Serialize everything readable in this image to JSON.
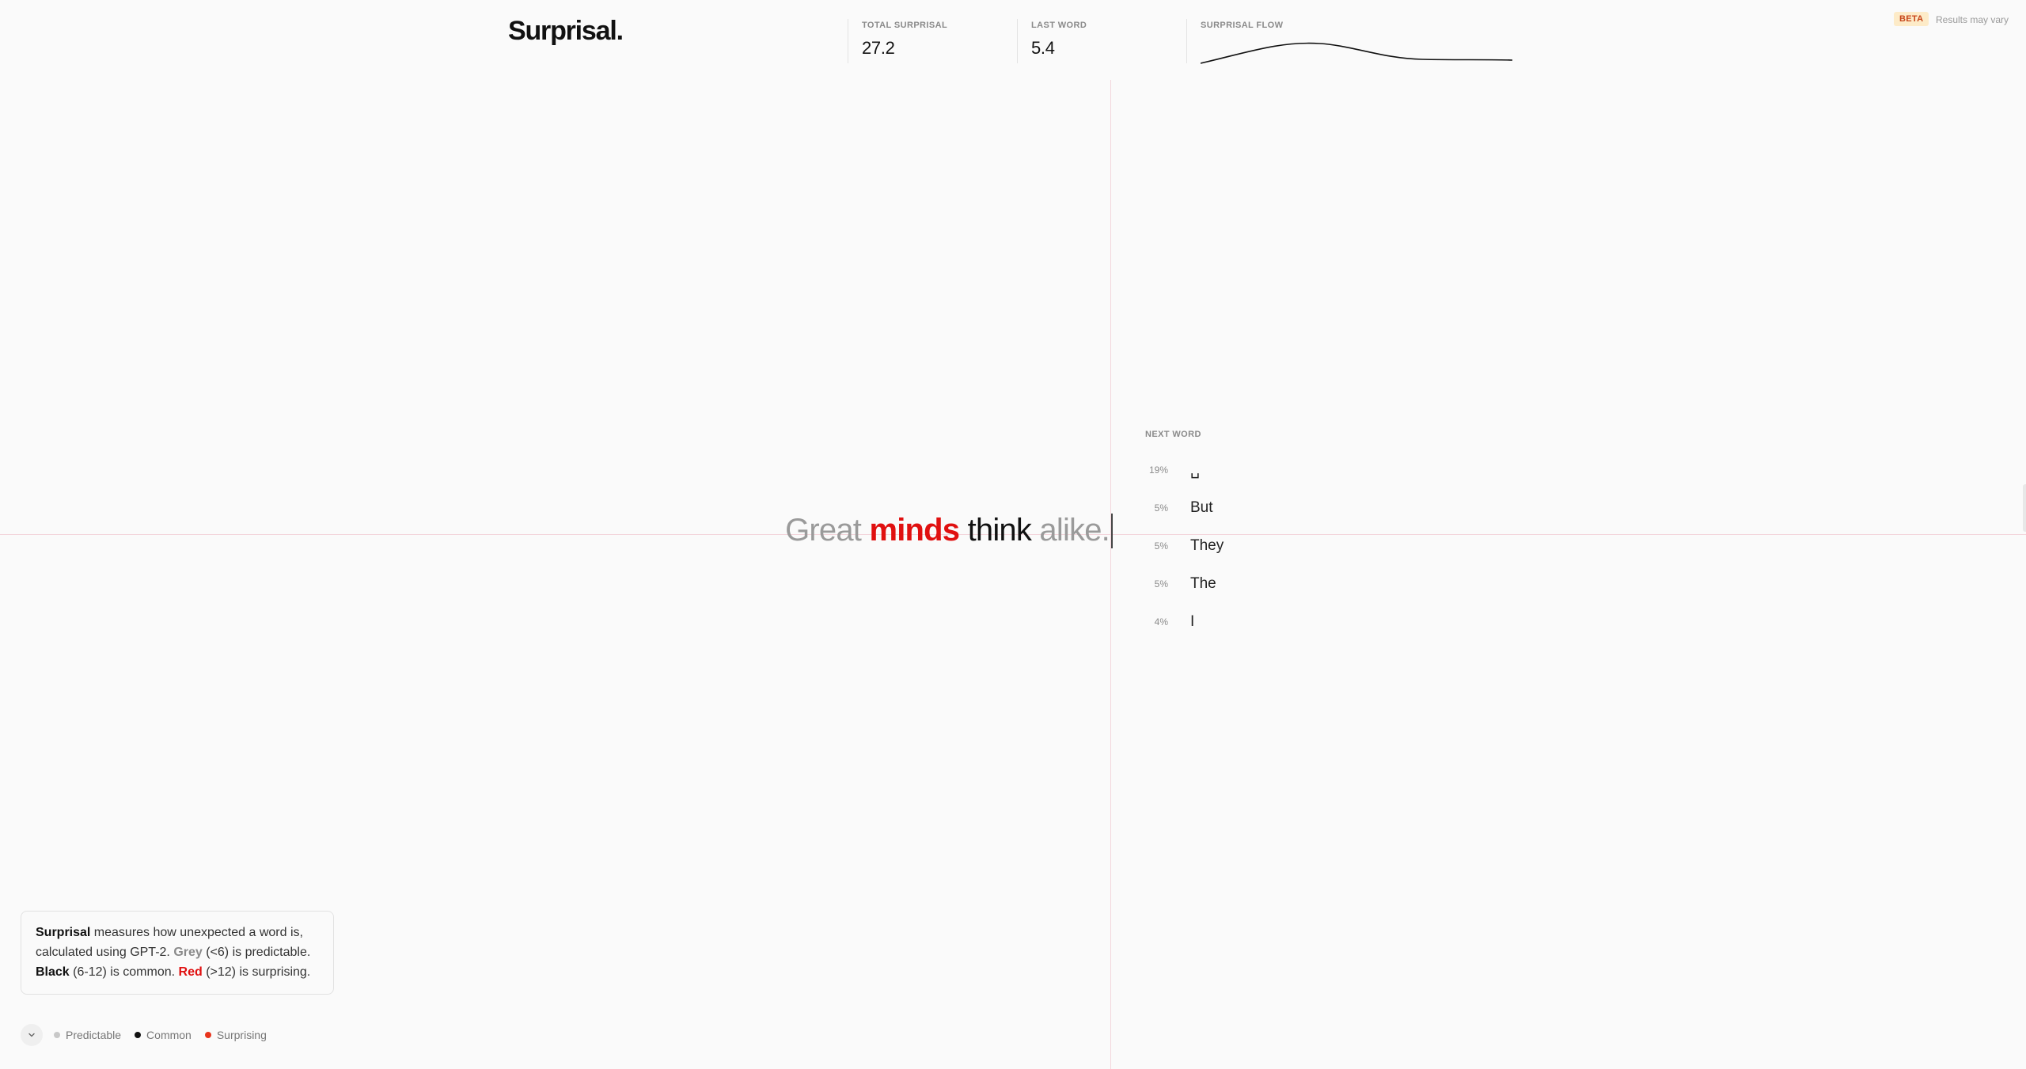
{
  "header": {
    "logo": "Surprisal.",
    "stats": [
      {
        "label": "TOTAL SURPRISAL",
        "value": "27.2"
      },
      {
        "label": "LAST WORD",
        "value": "5.4"
      },
      {
        "label": "SURPRISAL FLOW"
      }
    ],
    "badge": "BETA",
    "badge_note": "Results may vary"
  },
  "sentence": {
    "words": [
      {
        "text": "Great",
        "level": "grey"
      },
      {
        "text": "minds",
        "level": "red"
      },
      {
        "text": "think",
        "level": "black"
      },
      {
        "text": "alike.",
        "level": "grey"
      }
    ]
  },
  "next_word": {
    "title": "NEXT WORD",
    "items": [
      {
        "pct": "19%",
        "word": "␣"
      },
      {
        "pct": "5%",
        "word": "But"
      },
      {
        "pct": "5%",
        "word": "They"
      },
      {
        "pct": "5%",
        "word": "The"
      },
      {
        "pct": "4%",
        "word": "I"
      }
    ]
  },
  "info": {
    "term": "Surprisal",
    "text_1": " measures how unexpected a word is, calculated using GPT-2. ",
    "grey_label": "Grey",
    "text_2": " (<6) is predictable. ",
    "black_label": "Black",
    "text_3": " (6-12) is common. ",
    "red_label": "Red",
    "text_4": " (>12) is surprising."
  },
  "legend": {
    "items": [
      {
        "label": "Predictable",
        "color": "#c8c8c8"
      },
      {
        "label": "Common",
        "color": "#111111"
      },
      {
        "label": "Surprising",
        "color": "#e8341c"
      }
    ]
  },
  "colors": {
    "grey": "#9a9a9a",
    "black": "#111111",
    "red": "#e01010",
    "guide": "#f3d6dc"
  }
}
